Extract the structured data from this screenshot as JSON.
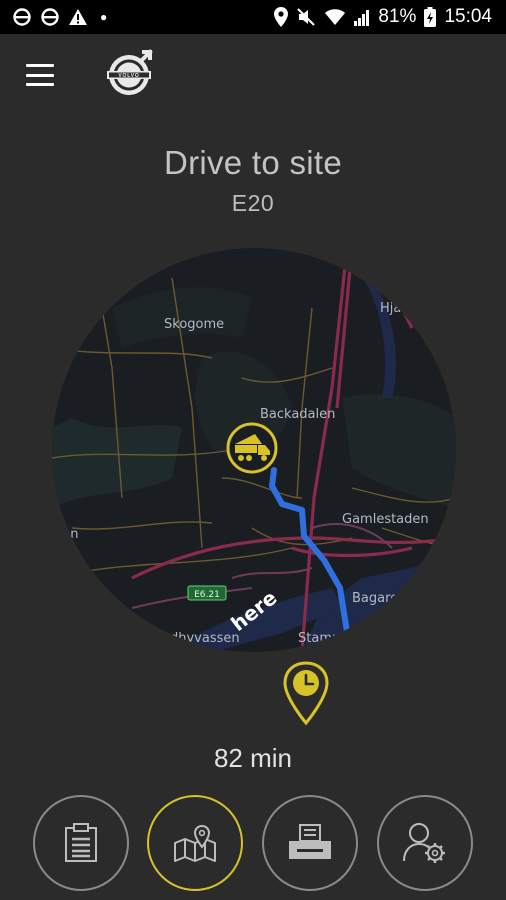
{
  "status_bar": {
    "battery": "81%",
    "time": "15:04"
  },
  "header": {
    "menu_icon": "hamburger-menu-icon",
    "logo": "volvo-logo",
    "logo_text": "VOLVO"
  },
  "main": {
    "title": "Drive to site",
    "subtitle": "E20",
    "eta": "82 min"
  },
  "map": {
    "labels": {
      "skogome": "Skogome",
      "backadalen": "Backadalen",
      "gamlestaden": "Gamlestaden",
      "bagaregard": "Bagaregård",
      "stampen": "Stampen",
      "hvassen": "dhyvassen",
      "den": "den",
      "hjal": "Hjäl",
      "road_shield": "E6.21",
      "provider": "here"
    },
    "route_color": "#2f6fe0",
    "truck_icon": "dump-truck-icon"
  },
  "bottom_nav": [
    {
      "name": "clipboard-icon"
    },
    {
      "name": "map-pin-icon",
      "active": true
    },
    {
      "name": "printer-icon"
    },
    {
      "name": "user-settings-icon"
    }
  ],
  "colors": {
    "accent": "#d7c228",
    "background": "#2b2b2b"
  }
}
